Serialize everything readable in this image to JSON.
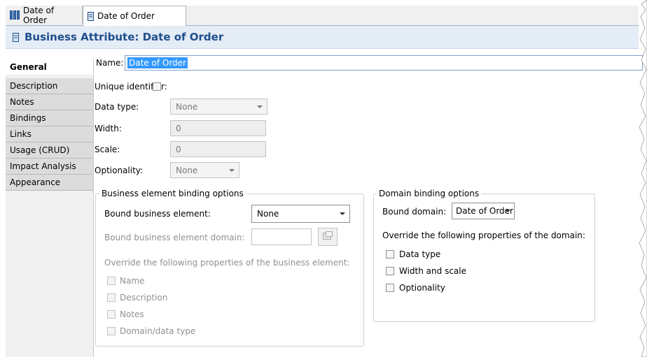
{
  "tabs": [
    {
      "label": "Date of Order",
      "icon": "model-icon"
    },
    {
      "label": "Date of Order",
      "icon": "attribute-icon"
    }
  ],
  "header": {
    "title": "Business Attribute: Date of Order"
  },
  "nav": {
    "items": [
      "General",
      "Description",
      "Notes",
      "Bindings",
      "Links",
      "Usage (CRUD)",
      "Impact Analysis",
      "Appearance"
    ],
    "active": "General"
  },
  "form": {
    "name_label": "Name:",
    "name_value": "Date of Order",
    "unique_label": "Unique identifier:",
    "datatype_label": "Data type:",
    "datatype_value": "None",
    "width_label": "Width:",
    "width_value": "0",
    "scale_label": "Scale:",
    "scale_value": "0",
    "optionality_label": "Optionality:",
    "optionality_value": "None"
  },
  "business_binding": {
    "legend": "Business element binding options",
    "bound_label": "Bound business element:",
    "bound_value": "None",
    "domain_label": "Bound business element domain:",
    "override_label": "Override the following properties of the business element:",
    "options": [
      "Name",
      "Description",
      "Notes",
      "Domain/data type"
    ]
  },
  "domain_binding": {
    "legend": "Domain binding options",
    "bound_label": "Bound domain:",
    "bound_value": "Date of Order",
    "override_label": "Override the following properties of the domain:",
    "options": [
      "Data type",
      "Width and scale",
      "Optionality"
    ]
  },
  "colors": {
    "header_title": "#1f4f8c",
    "selection": "#3399ff",
    "header_bg": "#e4ecf6"
  }
}
